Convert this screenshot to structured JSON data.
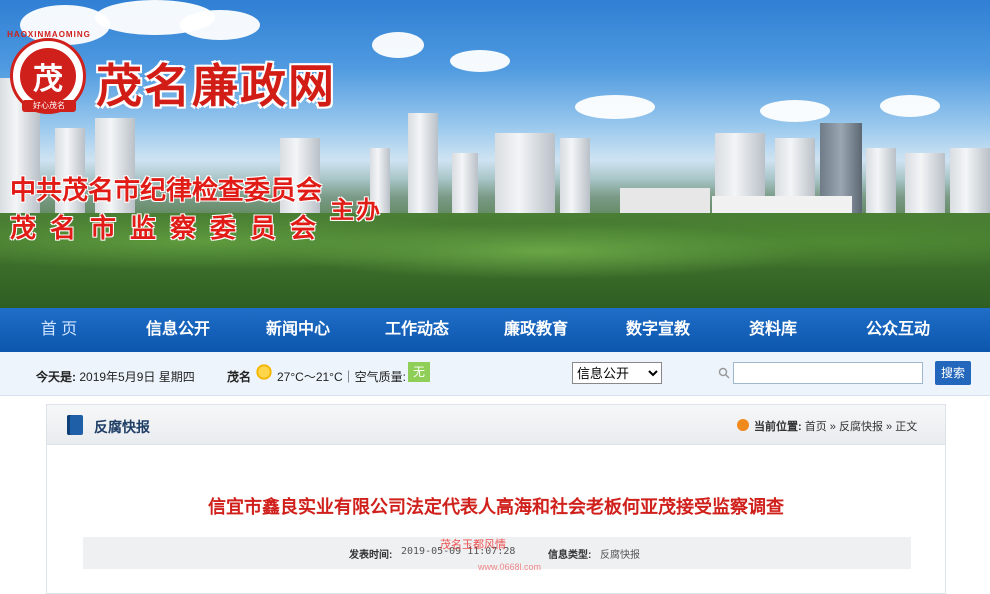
{
  "header": {
    "logo_ring_text": "HAOXINMAOMING",
    "logo_inner": "茂",
    "logo_tag": "好心茂名",
    "site_title": "茂名廉政网",
    "sponsor_line1": "中共茂名市纪律检查委员会",
    "sponsor_line2": "茂名市监察委员会",
    "sponsor_host": "主办"
  },
  "nav": {
    "items": [
      {
        "label": "首 页",
        "active": true
      },
      {
        "label": "信息公开"
      },
      {
        "label": "新闻中心"
      },
      {
        "label": "工作动态"
      },
      {
        "label": "廉政教育"
      },
      {
        "label": "数字宣教"
      },
      {
        "label": "资料库"
      },
      {
        "label": "公众互动"
      }
    ]
  },
  "info_bar": {
    "today_label": "今天是:",
    "date": "2019年5月9日 星期四",
    "city": "茂名",
    "weather": "27°C～21°C｜空气质量:",
    "air_quality": "无",
    "select_value": "信息公开",
    "search_placeholder": "",
    "search_button": "搜索"
  },
  "panel": {
    "section_title": "反腐快报",
    "location_label": "当前位置:",
    "breadcrumb": [
      "首页",
      "反腐快报",
      "正文"
    ],
    "breadcrumb_sep": "»",
    "article_title": "信宜市鑫良实业有限公司法定代表人高海和社会老板何亚茂接受监察调查",
    "publish_label": "发表时间:",
    "publish_time": "2019-05-09 11:07:28",
    "type_label": "信息类型:",
    "type_value": "反腐快报"
  },
  "watermark": {
    "text": "茂名玉都风情",
    "url": "www.0668l.com"
  },
  "colors": {
    "nav_bg": "#0d56ad",
    "title_red": "#d0201b",
    "info_bg": "#eef4fb"
  }
}
